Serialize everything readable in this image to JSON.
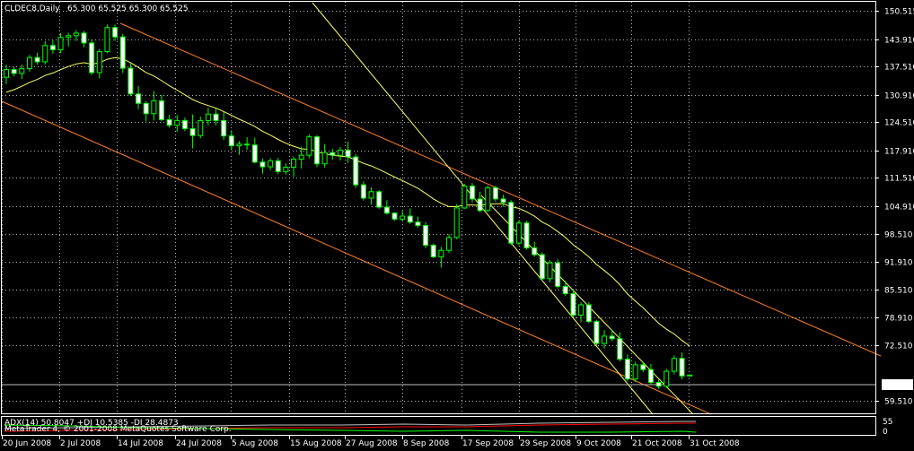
{
  "header": {
    "symbol_label": "CLDEC8,Daily",
    "ohlc_label": "65.300 65.525 65.300 65.525"
  },
  "indicator": {
    "label": "ADX(14) 50.8047 +DI 10.5385 -DI 28.4873",
    "copyright": "MetaTrader 4, © 2001-2008 MetaQuotes Software Corp."
  },
  "colors": {
    "background": "#000000",
    "grid": "#b8b8b8",
    "bull_candle": "#000000",
    "bear_candle": "#ffffff",
    "candle_outline": "#00ff00",
    "moving_average": "#ffff66",
    "channel": "#ff7f27",
    "trendline": "#ffff66",
    "price_line": "#c0c0c0",
    "adx_line": "#c0c0c0",
    "plus_di_line": "#00ff00",
    "minus_di_line": "#ff0000"
  },
  "chart_data": {
    "type": "candlestick",
    "timeframe": "Daily",
    "instrument": "CLDEC8",
    "price_axis": {
      "ticks": [
        "150.515",
        "143.910",
        "137.510",
        "130.910",
        "124.510",
        "117.910",
        "111.510",
        "104.910",
        "98.510",
        "91.910",
        "85.510",
        "78.910",
        "72.510",
        "65.525",
        "59.510"
      ],
      "tick_values": [
        150.515,
        143.91,
        137.51,
        130.91,
        124.51,
        117.91,
        111.51,
        104.91,
        98.51,
        91.91,
        85.51,
        78.91,
        72.51,
        59.51
      ],
      "current_price": 65.525,
      "range": [
        57.6,
        151.2
      ]
    },
    "time_axis": {
      "labels": [
        "20 Jun 2008",
        "2 Jul 2008",
        "14 Jul 2008",
        "24 Jul 2008",
        "5 Aug 2008",
        "15 Aug 2008",
        "27 Aug 2008",
        "8 Sep 2008",
        "17 Sep 2008",
        "29 Sep 2008",
        "9 Oct 2008",
        "21 Oct 2008",
        "31 Oct 2008"
      ],
      "first_date": "2008-06-20",
      "last_date": "2008-10-31"
    },
    "indicator_axis": {
      "ticks": [
        "55",
        "0"
      ]
    },
    "candles": [
      [
        135.0,
        137.9,
        133.4,
        136.8
      ],
      [
        136.8,
        137.4,
        135.2,
        135.9
      ],
      [
        135.9,
        138.0,
        134.6,
        137.0
      ],
      [
        137.0,
        140.2,
        136.3,
        139.6
      ],
      [
        139.6,
        140.7,
        137.9,
        138.6
      ],
      [
        138.6,
        143.4,
        138.0,
        142.4
      ],
      [
        142.4,
        143.6,
        140.5,
        141.4
      ],
      [
        141.4,
        145.3,
        140.7,
        144.3
      ],
      [
        144.3,
        145.4,
        142.2,
        144.7
      ],
      [
        144.7,
        146.0,
        143.5,
        145.3
      ],
      [
        145.3,
        145.8,
        142.0,
        143.0
      ],
      [
        143.0,
        143.7,
        135.5,
        136.1
      ],
      [
        136.1,
        141.6,
        134.7,
        141.0
      ],
      [
        141.0,
        147.3,
        140.6,
        146.6
      ],
      [
        146.6,
        147.3,
        143.5,
        144.4
      ],
      [
        144.4,
        145.1,
        136.0,
        137.1
      ],
      [
        137.1,
        138.4,
        130.6,
        131.1
      ],
      [
        131.1,
        133.0,
        127.6,
        128.9
      ],
      [
        128.9,
        129.4,
        124.7,
        126.5
      ],
      [
        126.5,
        131.8,
        124.9,
        129.5
      ],
      [
        129.5,
        130.9,
        124.7,
        125.1
      ],
      [
        125.1,
        126.2,
        123.2,
        123.8
      ],
      [
        123.8,
        126.2,
        122.3,
        124.9
      ],
      [
        124.9,
        125.6,
        122.4,
        123.0
      ],
      [
        123.0,
        126.3,
        118.4,
        121.4
      ],
      [
        121.4,
        125.8,
        120.8,
        124.9
      ],
      [
        124.9,
        127.9,
        123.7,
        126.4
      ],
      [
        126.4,
        127.8,
        123.8,
        124.9
      ],
      [
        124.9,
        126.9,
        120.4,
        121.3
      ],
      [
        121.3,
        122.6,
        118.1,
        119.0
      ],
      [
        119.0,
        120.1,
        116.9,
        119.4
      ],
      [
        119.4,
        121.0,
        118.1,
        119.2
      ],
      [
        119.2,
        120.9,
        114.9,
        115.2
      ],
      [
        115.2,
        116.0,
        112.5,
        114.1
      ],
      [
        114.1,
        116.1,
        113.3,
        115.5
      ],
      [
        115.5,
        116.2,
        112.4,
        113.0
      ],
      [
        113.0,
        114.9,
        112.3,
        114.0
      ],
      [
        114.0,
        116.5,
        111.7,
        115.9
      ],
      [
        115.9,
        118.8,
        113.7,
        116.8
      ],
      [
        116.8,
        121.7,
        116.1,
        121.1
      ],
      [
        121.1,
        121.5,
        114.0,
        114.8
      ],
      [
        114.8,
        119.4,
        113.9,
        117.4
      ],
      [
        117.4,
        118.3,
        115.8,
        116.8
      ],
      [
        116.8,
        118.7,
        115.6,
        118.0
      ],
      [
        118.0,
        120.0,
        115.0,
        116.4
      ],
      [
        116.4,
        117.1,
        109.2,
        109.9
      ],
      [
        109.9,
        110.7,
        106.2,
        106.8
      ],
      [
        106.8,
        109.3,
        105.3,
        108.3
      ],
      [
        108.3,
        108.7,
        104.3,
        104.7
      ],
      [
        104.7,
        106.3,
        102.9,
        103.3
      ],
      [
        103.3,
        103.5,
        101.5,
        101.9
      ],
      [
        101.9,
        103.8,
        101.5,
        102.6
      ],
      [
        102.6,
        104.4,
        100.8,
        101.2
      ],
      [
        101.2,
        102.5,
        99.9,
        100.4
      ],
      [
        100.4,
        101.2,
        95.1,
        95.8
      ],
      [
        95.8,
        96.2,
        92.8,
        93.1
      ],
      [
        93.1,
        95.4,
        90.6,
        94.6
      ],
      [
        94.6,
        98.4,
        94.0,
        97.6
      ],
      [
        97.6,
        105.4,
        97.2,
        104.5
      ],
      [
        104.5,
        110.1,
        104.3,
        109.6
      ],
      [
        109.6,
        110.3,
        105.8,
        106.6
      ],
      [
        106.6,
        108.3,
        103.5,
        103.9
      ],
      [
        103.9,
        109.7,
        103.6,
        109.2
      ],
      [
        109.2,
        109.7,
        105.9,
        106.6
      ],
      [
        106.6,
        107.6,
        104.8,
        105.8
      ],
      [
        105.8,
        106.3,
        95.9,
        96.3
      ],
      [
        96.3,
        101.6,
        95.8,
        101.0
      ],
      [
        101.0,
        101.5,
        94.8,
        95.2
      ],
      [
        95.2,
        96.6,
        93.1,
        93.6
      ],
      [
        93.6,
        94.1,
        87.5,
        88.0
      ],
      [
        88.0,
        92.3,
        87.1,
        91.7
      ],
      [
        91.7,
        92.5,
        85.7,
        86.2
      ],
      [
        86.2,
        87.5,
        84.0,
        84.5
      ],
      [
        84.5,
        85.6,
        79.0,
        79.5
      ],
      [
        79.5,
        82.5,
        77.8,
        81.9
      ],
      [
        81.9,
        82.5,
        77.6,
        78.0
      ],
      [
        78.0,
        78.4,
        72.4,
        72.9
      ],
      [
        72.9,
        76.0,
        71.7,
        74.6
      ],
      [
        74.6,
        76.1,
        73.4,
        74.0
      ],
      [
        74.0,
        75.5,
        68.7,
        69.2
      ],
      [
        69.2,
        70.3,
        64.0,
        64.6
      ],
      [
        64.6,
        68.6,
        63.9,
        67.9
      ],
      [
        67.9,
        68.6,
        66.2,
        66.8
      ],
      [
        66.8,
        68.1,
        63.3,
        63.8
      ],
      [
        63.8,
        64.4,
        62.3,
        62.9
      ],
      [
        62.9,
        67.0,
        62.5,
        66.4
      ],
      [
        66.4,
        70.1,
        65.7,
        69.4
      ],
      [
        69.4,
        70.8,
        64.5,
        65.3
      ],
      [
        65.3,
        65.525,
        65.3,
        65.525
      ]
    ],
    "moving_average": [
      131.5,
      132.1,
      132.9,
      133.8,
      134.5,
      135.4,
      136.0,
      136.8,
      137.5,
      138.1,
      138.4,
      138.0,
      138.4,
      139.2,
      139.6,
      139.3,
      138.4,
      137.3,
      136.1,
      135.3,
      134.2,
      133.0,
      132.0,
      130.9,
      129.8,
      129.0,
      128.4,
      127.8,
      127.0,
      126.1,
      125.2,
      124.4,
      123.5,
      122.4,
      121.5,
      120.5,
      119.6,
      118.9,
      118.3,
      118.2,
      117.6,
      117.2,
      116.8,
      116.6,
      116.4,
      115.7,
      114.9,
      114.3,
      113.5,
      112.6,
      111.7,
      110.9,
      110.0,
      109.1,
      107.9,
      106.6,
      105.6,
      104.8,
      104.8,
      105.2,
      105.2,
      105.1,
      105.4,
      105.5,
      105.5,
      104.8,
      104.4,
      103.6,
      102.6,
      101.2,
      100.3,
      99.0,
      97.6,
      95.9,
      94.6,
      93.1,
      91.3,
      89.9,
      88.4,
      86.6,
      84.4,
      82.8,
      81.2,
      79.4,
      77.6,
      76.2,
      75.1,
      73.6,
      72.3
    ],
    "indicator": {
      "name": "ADX(14)",
      "adx": 50.8047,
      "plus_di": 10.5385,
      "minus_di": 28.4873
    }
  }
}
